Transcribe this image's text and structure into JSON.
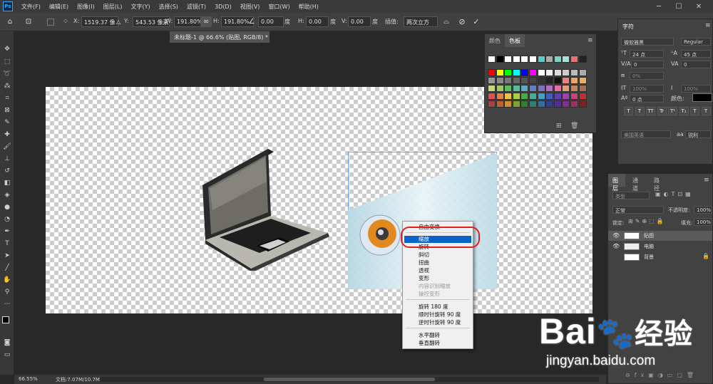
{
  "app": {
    "logo_text": "Ps"
  },
  "menubar": {
    "items": [
      "文件(F)",
      "编辑(E)",
      "图像(I)",
      "图层(L)",
      "文字(Y)",
      "选择(S)",
      "滤镜(T)",
      "3D(D)",
      "视图(V)",
      "窗口(W)",
      "帮助(H)"
    ]
  },
  "window_controls": {
    "minimize": "─",
    "maximize": "☐",
    "close": "✕"
  },
  "options": {
    "x_label": "X:",
    "x_value": "1519.37 像",
    "y_label": "Y:",
    "y_value": "543.53 像素",
    "w_label": "W:",
    "w_value": "191.80%",
    "h_label": "H:",
    "h_value": "191.80%",
    "angle_value": "0.00",
    "angle_unit": "度",
    "hskew_label": "H:",
    "hskew_value": "0.00",
    "hskew_unit": "度",
    "vskew_label": "V:",
    "vskew_value": "0.00",
    "vskew_unit": "度",
    "interp_label": "插值:",
    "interp_value": "两次立方"
  },
  "document": {
    "tab_title": "未标题-1 @ 66.6% (贴图, RGB/8) *",
    "tab_close": "×"
  },
  "status": {
    "zoom": "66.55%",
    "doc_info": "文档:7.07M/10.7M"
  },
  "swatch_panel": {
    "tabs": [
      "颜色",
      "色板"
    ],
    "active_tab": "色板",
    "colors": [
      [
        "#ffffff",
        "#000000",
        "#ffffff",
        "#ffffff",
        "#ffffff",
        "#ffffff",
        "#5fc8c8",
        "#aaaaaa",
        "#80d0c0",
        "#a8e0d8",
        "#e87070",
        "#222222"
      ],
      [
        "#ff0000",
        "#ffff00",
        "#00ff00",
        "#00ffff",
        "#0000ff",
        "#ff00ff",
        "#ffffff",
        "#eeeeee",
        "#dddddd",
        "#cccccc",
        "#bbbbbb",
        "#aaaaaa"
      ],
      [
        "#999999",
        "#888888",
        "#777777",
        "#666666",
        "#555555",
        "#444444",
        "#333333",
        "#222222",
        "#111111",
        "#f08080",
        "#f4a460",
        "#e8b060"
      ],
      [
        "#c8d870",
        "#a0c860",
        "#60b860",
        "#60b8a0",
        "#60a8c8",
        "#6080c0",
        "#8070c0",
        "#b070c0",
        "#e070a0",
        "#e0a070",
        "#c08860",
        "#a07050"
      ],
      [
        "#e85050",
        "#e88040",
        "#f0c040",
        "#a8d040",
        "#40b040",
        "#40b090",
        "#40a0d0",
        "#4060c0",
        "#6040b0",
        "#a040b0",
        "#d04080",
        "#c03030"
      ],
      [
        "#b04040",
        "#c06030",
        "#d09030",
        "#80a030",
        "#308030",
        "#308070",
        "#3070a0",
        "#304090",
        "#503090",
        "#803090",
        "#a03060",
        "#802020"
      ]
    ]
  },
  "char_panel": {
    "title": "字符",
    "font_family": "微软雅黑",
    "font_style": "Regular",
    "size": "24 点",
    "leading": "45 点",
    "kerning": "0",
    "tracking": "0",
    "scale_pct": "0%",
    "vscale": "100%",
    "hscale": "100%",
    "baseline": "0 点",
    "color_label": "颜色:",
    "language": "美国英语",
    "aa_label": "aa",
    "aa_value": "锐利",
    "style_buttons": [
      "T",
      "T",
      "TT",
      "Tr",
      "T¹",
      "T₁",
      "T",
      "T"
    ]
  },
  "layers_panel": {
    "tabs": [
      "图层",
      "通道",
      "路径"
    ],
    "filter_label": "类型",
    "blend_mode": "正常",
    "opacity_label": "不透明度:",
    "opacity_value": "100%",
    "lock_label": "锁定:",
    "fill_label": "填充:",
    "fill_value": "100%",
    "layers": [
      {
        "name": "贴图",
        "visible": true,
        "selected": true
      },
      {
        "name": "电脑",
        "visible": true,
        "selected": false
      },
      {
        "name": "背景",
        "visible": false,
        "selected": false
      }
    ]
  },
  "context_menu": {
    "items": [
      {
        "label": "自由变换",
        "disabled": false
      },
      {
        "label": "缩放",
        "disabled": false,
        "selected": true
      },
      {
        "label": "旋转",
        "disabled": false
      },
      {
        "label": "斜切",
        "disabled": false
      },
      {
        "label": "扭曲",
        "disabled": false
      },
      {
        "label": "透视",
        "disabled": false
      },
      {
        "label": "变形",
        "disabled": false
      },
      {
        "label": "内容识别缩放",
        "disabled": true
      },
      {
        "label": "操控变形",
        "disabled": true
      },
      {
        "label": "旋转 180 度",
        "disabled": false
      },
      {
        "label": "顺时针旋转 90 度",
        "disabled": false
      },
      {
        "label": "逆时针旋转 90 度",
        "disabled": false
      },
      {
        "label": "水平翻转",
        "disabled": false
      },
      {
        "label": "垂直翻转",
        "disabled": false
      }
    ]
  },
  "watermark": {
    "brand": "Bai",
    "brand_cn": "经验",
    "url": "jingyan.baidu.com"
  },
  "colors": {
    "accent_selected": "#0a64c8",
    "highlight_ring": "#e02020",
    "ps_blue": "#31a8ff"
  }
}
